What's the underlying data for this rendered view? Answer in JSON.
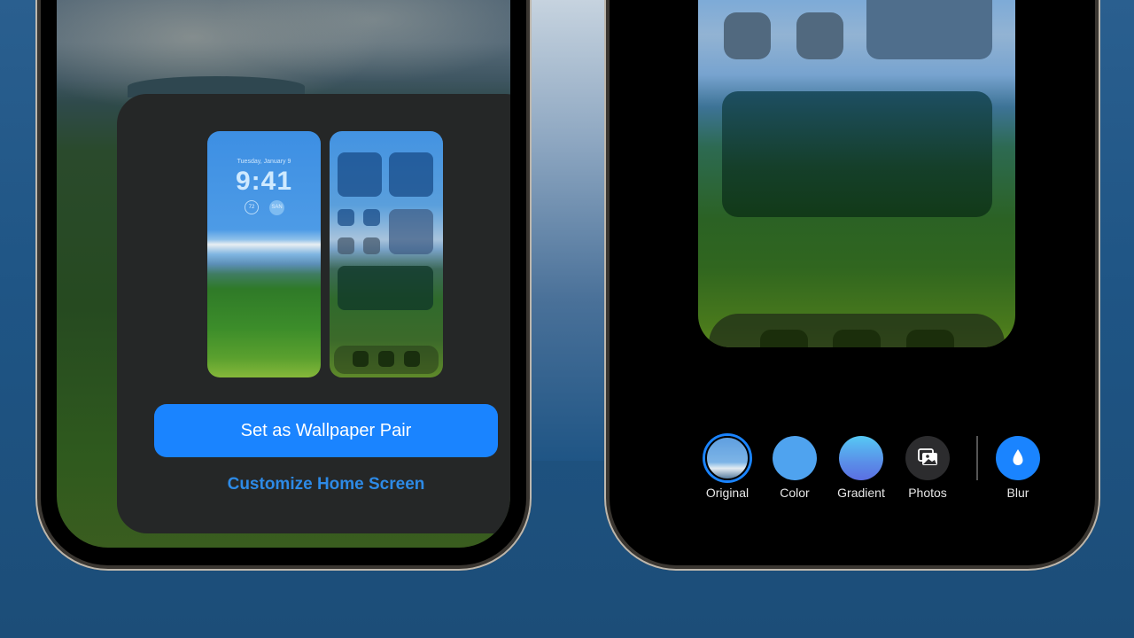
{
  "left_phone": {
    "lock_preview": {
      "date": "Tuesday, January 9",
      "time": "9:41",
      "widgets": [
        {
          "name": "temperature-gauge",
          "value": "72"
        },
        {
          "name": "weather-widget",
          "value": "SAN"
        }
      ]
    },
    "primary_button_label": "Set as Wallpaper Pair",
    "secondary_link_label": "Customize Home Screen"
  },
  "right_phone": {
    "options": [
      {
        "label": "Original",
        "icon": "wallpaper-thumbnail",
        "selected": true
      },
      {
        "label": "Color",
        "icon": "solid-color-swatch",
        "selected": false
      },
      {
        "label": "Gradient",
        "icon": "gradient-swatch",
        "selected": false
      },
      {
        "label": "Photos",
        "icon": "photos-icon",
        "selected": false
      },
      {
        "label": "Blur",
        "icon": "droplet-icon",
        "selected": true
      }
    ]
  },
  "colors": {
    "accent": "#1a84ff",
    "link": "#2d8ae6",
    "modal_bg": "#252727",
    "background": "#1f5585"
  }
}
